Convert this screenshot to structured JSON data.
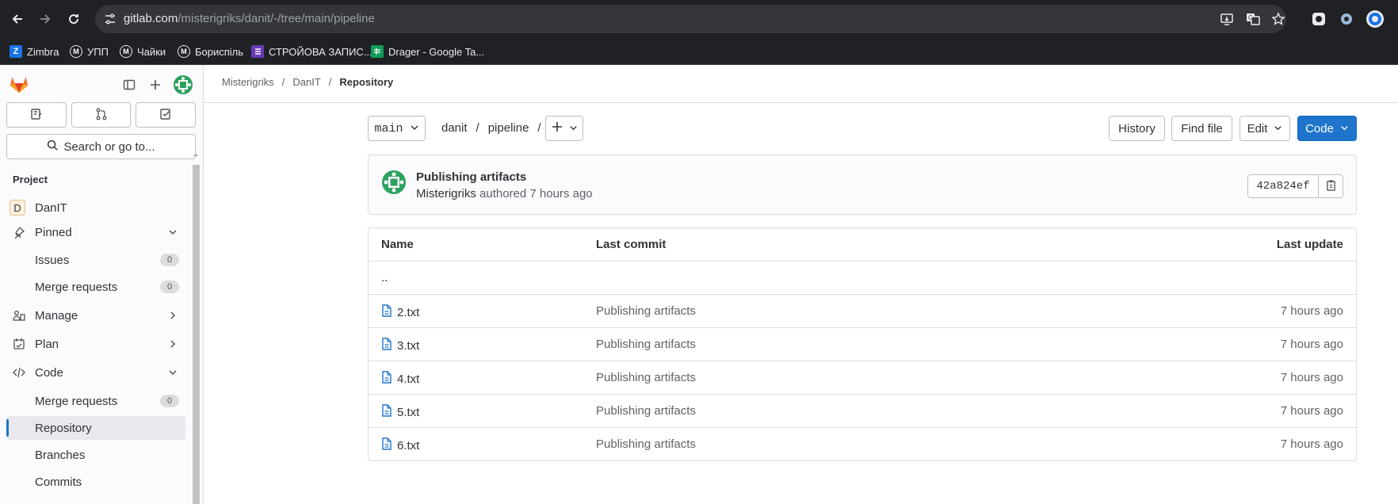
{
  "browser": {
    "url_host": "gitlab.com",
    "url_path": "/misterigriks/danit/-/tree/main/pipeline",
    "bookmarks": [
      {
        "label": "Zimbra",
        "icon": "Z",
        "color": "#1a73e8"
      },
      {
        "label": "УПП",
        "icon": "M",
        "color": "#202124"
      },
      {
        "label": "Чайки",
        "icon": "M",
        "color": "#202124"
      },
      {
        "label": "Бориспіль",
        "icon": "M",
        "color": "#202124"
      },
      {
        "label": "СТРОЙОВА ЗАПИС...",
        "icon": "list",
        "color": "#673ab7"
      },
      {
        "label": "Drager - Google Ta...",
        "icon": "sheet",
        "color": "#0f9d58"
      }
    ]
  },
  "sidebar": {
    "search_label": "Search or go to...",
    "section_title": "Project",
    "project": {
      "initial": "D",
      "name": "DanIT"
    },
    "items": [
      {
        "label": "Pinned",
        "icon": "pin-icon",
        "chevron": "down"
      },
      {
        "label": "Issues",
        "badge": "0"
      },
      {
        "label": "Merge requests",
        "badge": "0"
      },
      {
        "label": "Manage",
        "icon": "manage-icon",
        "chevron": "right"
      },
      {
        "label": "Plan",
        "icon": "plan-icon",
        "chevron": "right"
      },
      {
        "label": "Code",
        "icon": "code-icon",
        "chevron": "down"
      },
      {
        "label": "Merge requests",
        "badge": "0"
      },
      {
        "label": "Repository",
        "active": true
      },
      {
        "label": "Branches"
      },
      {
        "label": "Commits"
      }
    ]
  },
  "breadcrumb": [
    "Misterigriks",
    "DanIT",
    "Repository"
  ],
  "toolbar": {
    "branch": "main",
    "path": [
      "danit",
      "pipeline"
    ],
    "history": "History",
    "find_file": "Find file",
    "edit": "Edit",
    "code": "Code"
  },
  "commit": {
    "title": "Publishing artifacts",
    "author": "Misterigriks",
    "meta": "authored 7 hours ago",
    "sha": "42a824ef"
  },
  "table": {
    "headers": [
      "Name",
      "Last commit",
      "Last update"
    ],
    "parent": "..",
    "rows": [
      {
        "name": "2.txt",
        "commit": "Publishing artifacts",
        "updated": "7 hours ago"
      },
      {
        "name": "3.txt",
        "commit": "Publishing artifacts",
        "updated": "7 hours ago"
      },
      {
        "name": "4.txt",
        "commit": "Publishing artifacts",
        "updated": "7 hours ago"
      },
      {
        "name": "5.txt",
        "commit": "Publishing artifacts",
        "updated": "7 hours ago"
      },
      {
        "name": "6.txt",
        "commit": "Publishing artifacts",
        "updated": "7 hours ago"
      }
    ]
  },
  "colors": {
    "accent": "#1f75cb",
    "gitlab_orange": "#fc6d26",
    "avatar_green": "#2da160"
  }
}
